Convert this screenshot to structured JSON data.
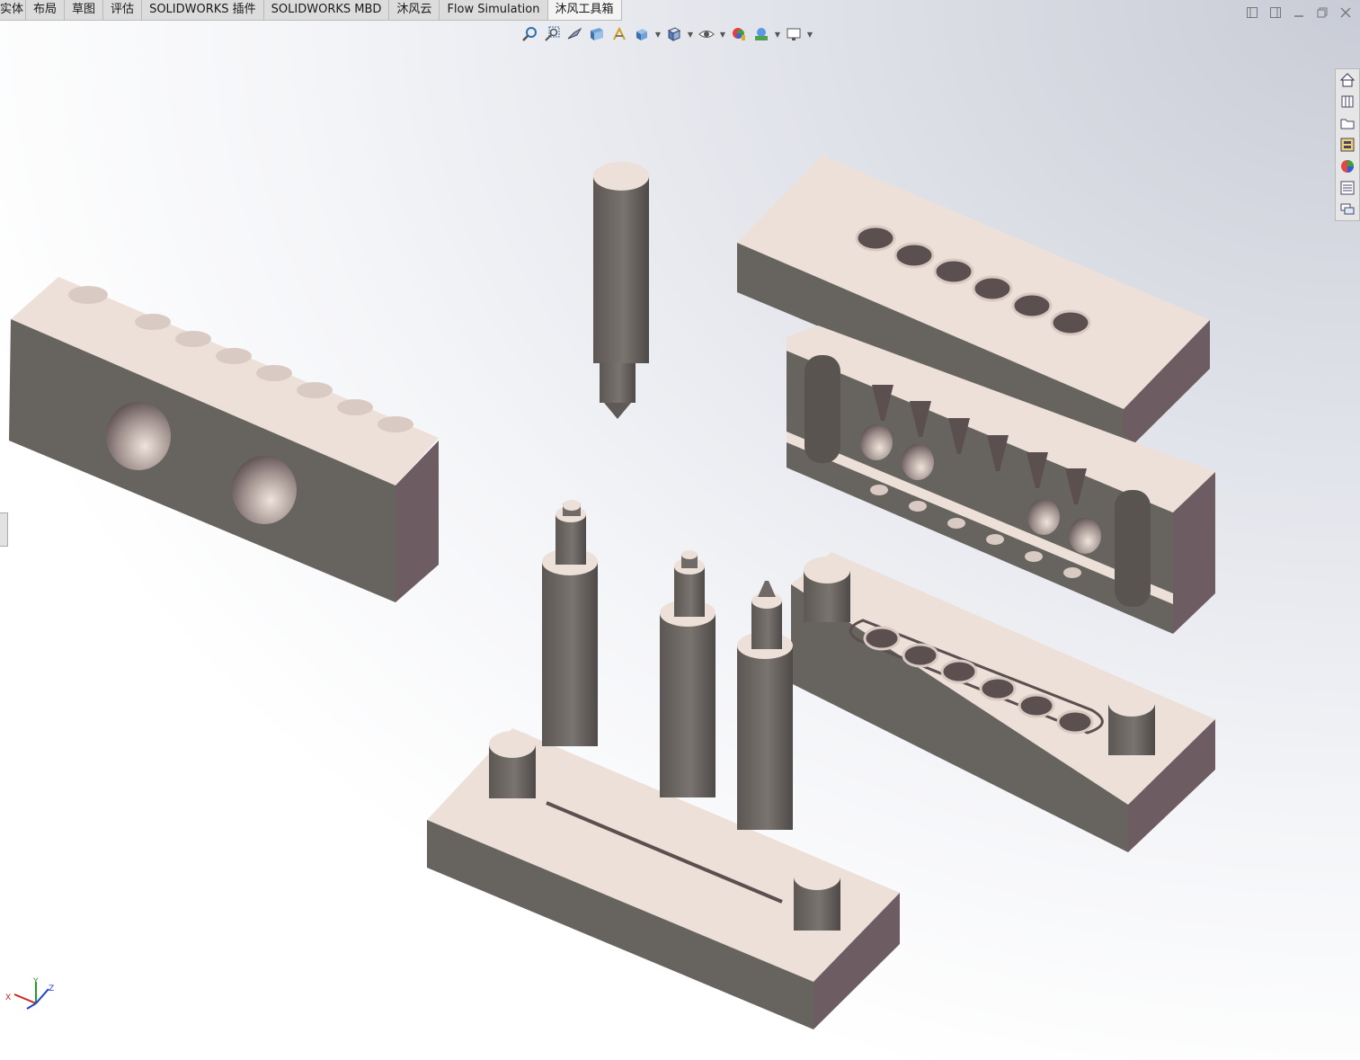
{
  "tabs": [
    {
      "label": "实体",
      "active": false
    },
    {
      "label": "布局",
      "active": false
    },
    {
      "label": "草图",
      "active": false
    },
    {
      "label": "评估",
      "active": false
    },
    {
      "label": "SOLIDWORKS 插件",
      "active": false
    },
    {
      "label": "SOLIDWORKS MBD",
      "active": false
    },
    {
      "label": "沐风云",
      "active": false
    },
    {
      "label": "Flow Simulation",
      "active": false
    },
    {
      "label": "沐风工具箱",
      "active": true
    }
  ],
  "view_tools": [
    "zoom-to-fit-icon",
    "zoom-to-area-icon",
    "previous-view-icon",
    "section-view-icon",
    "dynamic-annotation-icon",
    "view-orientation-icon",
    "display-style-icon",
    "hide-show-items-icon",
    "edit-appearance-icon",
    "apply-scene-icon",
    "view-settings-icon"
  ],
  "task_pane": [
    "home-icon",
    "design-library-icon",
    "file-explorer-icon",
    "view-palette-icon",
    "appearances-icon",
    "custom-properties-icon",
    "forum-icon"
  ],
  "triad": {
    "x_label": "X",
    "y_label": "Y",
    "z_label": "Z"
  },
  "colors": {
    "face_top": "#ede0d8",
    "face_front": "#6a6662",
    "face_side": "#6f5c63",
    "hole": "#5a4f50"
  }
}
